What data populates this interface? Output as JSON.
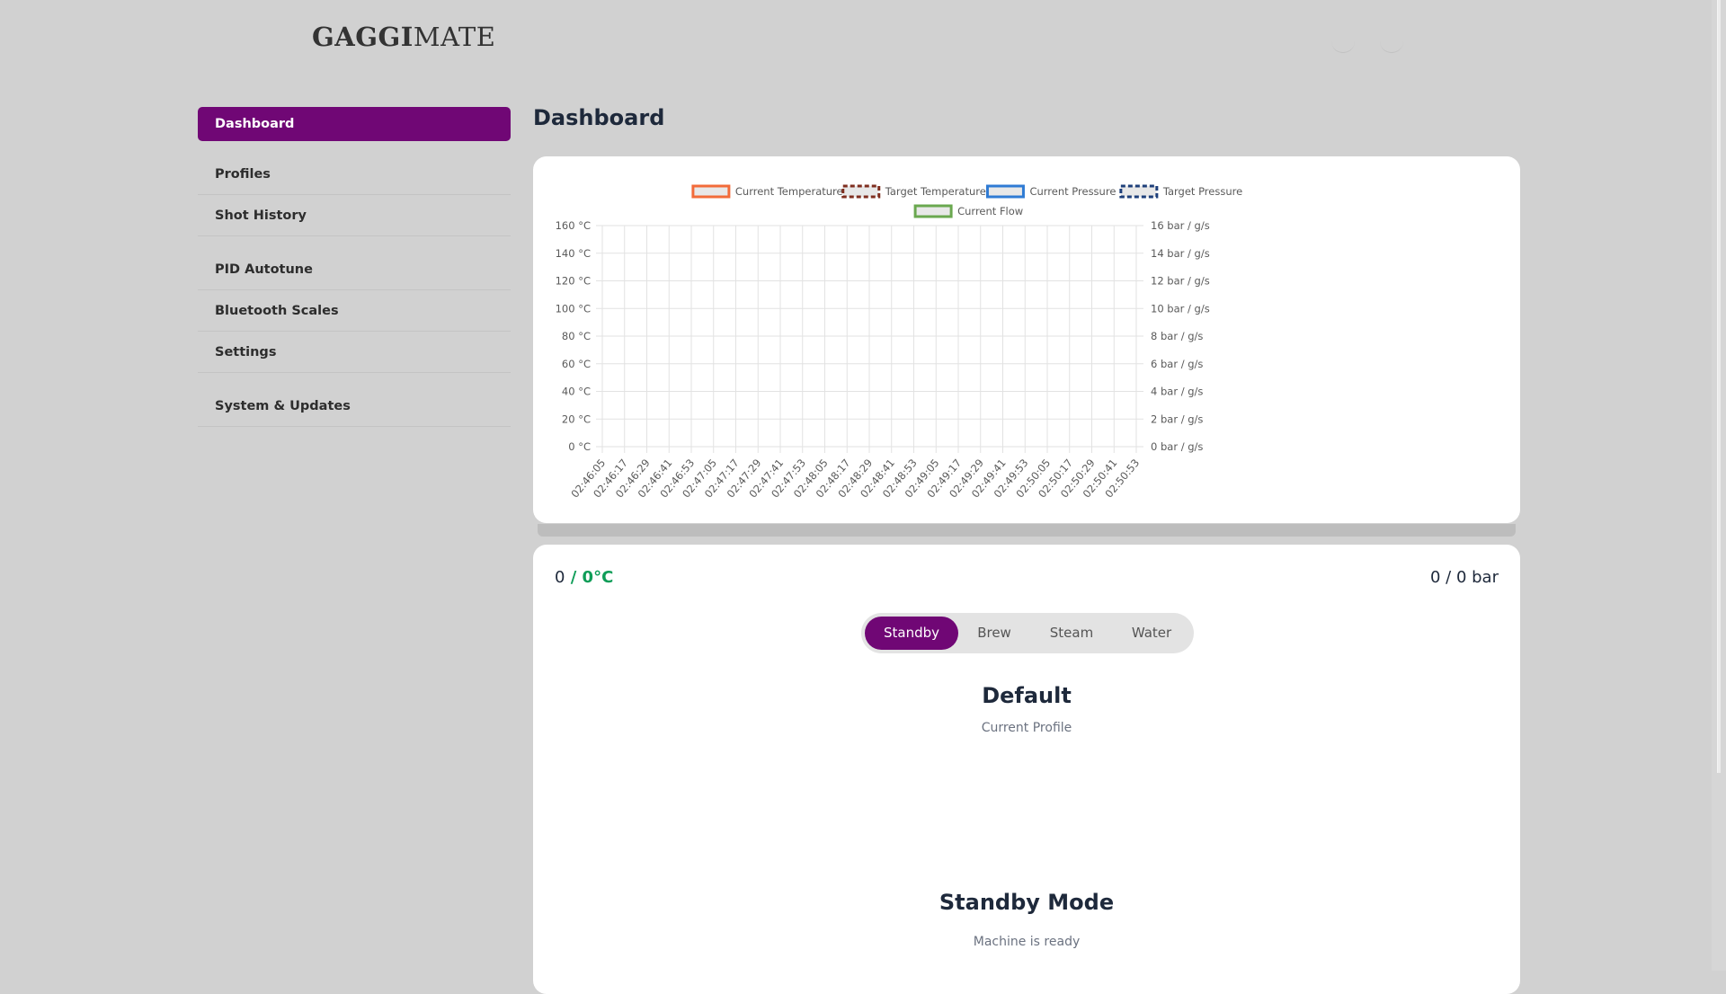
{
  "brand": {
    "name_bold": "GAGGI",
    "name_light": "MATE"
  },
  "header": {
    "icons": [
      "sun-icon",
      "github-icon"
    ]
  },
  "sidebar": {
    "items": [
      {
        "label": "Dashboard",
        "active": true
      },
      {
        "label": "Profiles"
      },
      {
        "label": "Shot History"
      },
      {
        "label": "PID Autotune"
      },
      {
        "label": "Bluetooth Scales"
      },
      {
        "label": "Settings"
      },
      {
        "label": "System & Updates"
      }
    ]
  },
  "page": {
    "title": "Dashboard"
  },
  "colors": {
    "accent": "#700775",
    "temp_ok": "#0f9d58"
  },
  "chart_data": {
    "type": "line",
    "legend": [
      {
        "name": "Current Temperature",
        "color": "#f26b3a",
        "style": "solid"
      },
      {
        "name": "Target Temperature",
        "color": "#7f2e1f",
        "style": "dashed"
      },
      {
        "name": "Current Pressure",
        "color": "#2f7bd4",
        "style": "solid"
      },
      {
        "name": "Target Pressure",
        "color": "#1e3f7a",
        "style": "dashed"
      },
      {
        "name": "Current Flow",
        "color": "#6aa84f",
        "style": "solid"
      }
    ],
    "legend_position": "top",
    "grid": true,
    "y_left": {
      "ticks": [
        "160 °C",
        "140 °C",
        "120 °C",
        "100 °C",
        "80 °C",
        "60 °C",
        "40 °C",
        "20 °C",
        "0 °C"
      ],
      "range": [
        0,
        160
      ]
    },
    "y_right": {
      "ticks": [
        "16 bar / g/s",
        "14 bar / g/s",
        "12 bar / g/s",
        "10 bar / g/s",
        "8 bar / g/s",
        "6 bar / g/s",
        "4 bar / g/s",
        "2 bar / g/s",
        "0 bar / g/s"
      ],
      "range": [
        0,
        16
      ]
    },
    "x": [
      "02:46:05",
      "02:46:17",
      "02:46:29",
      "02:46:41",
      "02:46:53",
      "02:47:05",
      "02:47:17",
      "02:47:29",
      "02:47:41",
      "02:47:53",
      "02:48:05",
      "02:48:17",
      "02:48:29",
      "02:48:41",
      "02:48:53",
      "02:49:05",
      "02:49:17",
      "02:49:29",
      "02:49:41",
      "02:49:53",
      "02:50:05",
      "02:50:17",
      "02:50:29",
      "02:50:41",
      "02:50:53"
    ],
    "series": []
  },
  "status": {
    "temp_current": "0",
    "temp_target": " / 0°C",
    "pressure": "0 / 0 bar",
    "modes": [
      "Standby",
      "Brew",
      "Steam",
      "Water"
    ],
    "active_mode": "Standby",
    "profile_name": "Default",
    "profile_caption": "Current Profile",
    "mode_title": "Standby Mode",
    "mode_caption": "Machine is ready"
  }
}
